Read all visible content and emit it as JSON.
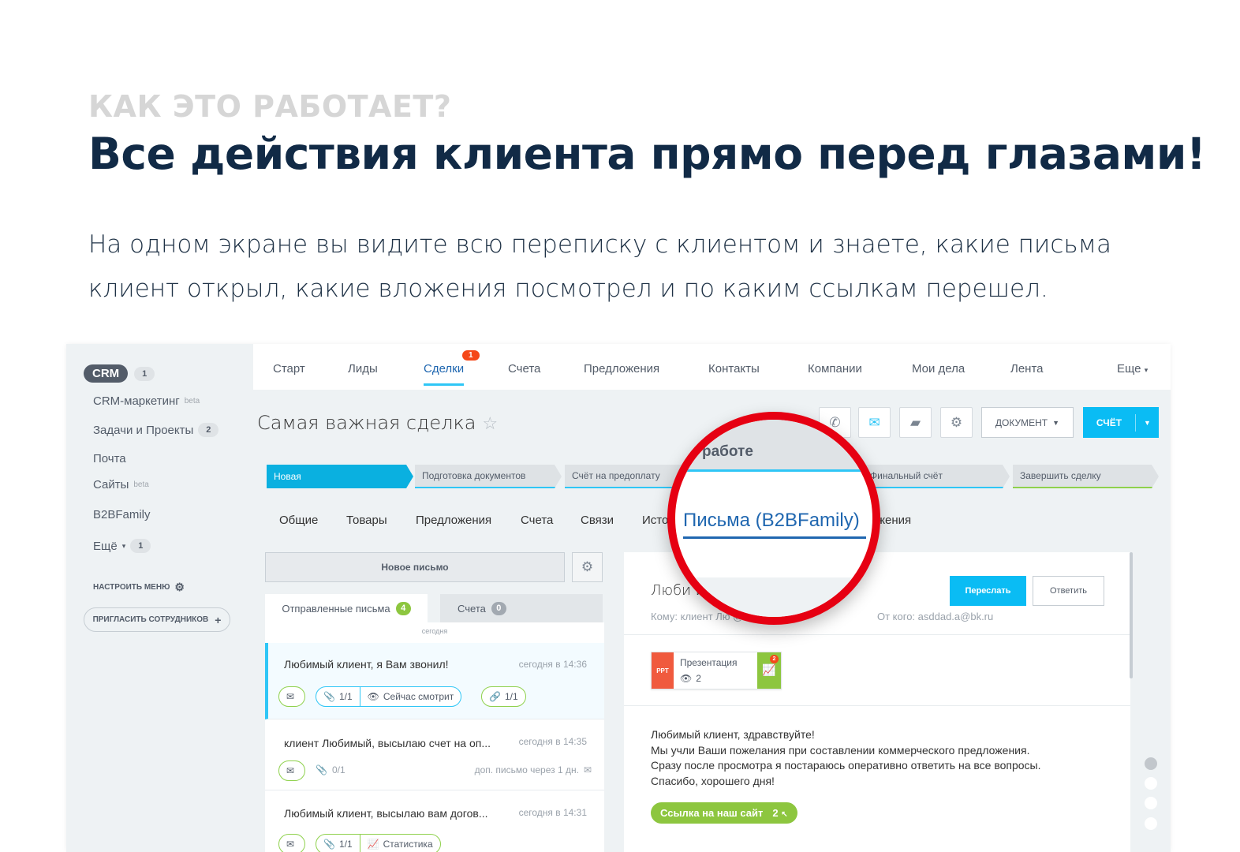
{
  "hero": {
    "kicker": "КАК ЭТО РАБОТАЕТ?",
    "headline": "Все действия клиента прямо перед глазами!",
    "lead": "На одном экране вы видите всю переписку с клиентом и знаете, какие письма клиент открыл, какие вложения посмотрел и по каким ссылкам перешел."
  },
  "sidebar": {
    "crm_label": "CRM",
    "crm_count": "1",
    "items": [
      {
        "label": "CRM-маркетинг",
        "sup": "beta",
        "count": ""
      },
      {
        "label": "Задачи и Проекты",
        "sup": "",
        "count": "2"
      },
      {
        "label": "Почта",
        "sup": "",
        "count": ""
      },
      {
        "label": "Сайты",
        "sup": "beta",
        "count": ""
      },
      {
        "label": "B2BFamily",
        "sup": "",
        "count": ""
      },
      {
        "label": "Ещё",
        "sup": "",
        "count": "1"
      }
    ],
    "configure_menu": "НАСТРОИТЬ МЕНЮ",
    "invite": "ПРИГЛАСИТЬ СОТРУДНИКОВ"
  },
  "topnav": {
    "items": [
      "Старт",
      "Лиды",
      "Сделки",
      "Счета",
      "Предложения",
      "Контакты",
      "Компании",
      "Мои дела",
      "Лента",
      "Еще"
    ],
    "deals_badge": "1"
  },
  "deal": {
    "title": "Самая важная сделка",
    "document_button": "ДОКУМЕНТ",
    "invoice_button": "СЧЁТ"
  },
  "stages": [
    "Новая",
    "Подготовка документов",
    "Счёт на предоплату",
    "Финальный счёт",
    "Завершить сделку"
  ],
  "tabs": [
    "Общие",
    "Товары",
    "Предложения",
    "Счета",
    "Связи",
    "Исто",
    "жения"
  ],
  "mail": {
    "new_mail": "Новое письмо",
    "tab_sent": "Отправленные письма",
    "tab_sent_count": "4",
    "tab_invoices": "Счета",
    "tab_invoices_count": "0",
    "day": "сегодня",
    "rows": [
      {
        "subject": "Любимый клиент, я Вам звонил!",
        "time": "сегодня в 14:36",
        "attach": "1/1",
        "status": "Сейчас смотрит",
        "links": "1/1"
      },
      {
        "subject": "клиент Любимый, высылаю счет на оп...",
        "time": "сегодня в 14:35",
        "attach": "0/1",
        "extra": "доп. письмо через 1 дн."
      },
      {
        "subject": "Любимый клиент, высылаю вам догов...",
        "time": "сегодня в 14:31",
        "attach": "1/1",
        "status": "Статистика"
      }
    ]
  },
  "detail": {
    "subject": "Люби                              ил!",
    "to": "Кому: клиент Лю                              @bk.ru",
    "from": "От кого: asddad.a@bk.ru",
    "forward": "Переслать",
    "reply": "Ответить",
    "attachment_name": "Презентация",
    "attachment_type": "PPT",
    "attachment_views": "2",
    "attachment_badge": "2",
    "body": [
      "Любимый клиент, здравствуйте!",
      "Мы учли Ваши пожелания при составлении коммерческого предложения.",
      "Сразу после просмотра я постараюсь оперативно ответить на все вопросы.",
      "Спасибо, хорошего дня!"
    ],
    "link_label": "Ссылка на наш сайт",
    "link_count": "2"
  },
  "magnifier": {
    "stage_fragment": "работе",
    "tab": "Письма (B2BFamily)"
  },
  "colors": {
    "accent": "#0abcf4",
    "success": "#8dc63f",
    "magnifier_ring": "#e60012",
    "headline": "#112a46"
  }
}
